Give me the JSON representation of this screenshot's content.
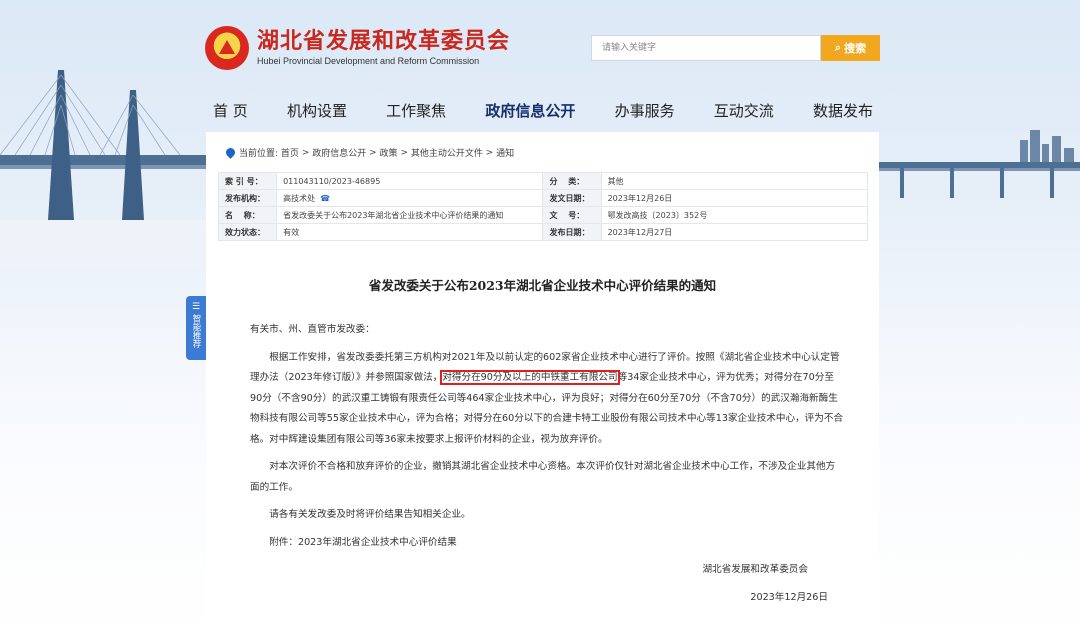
{
  "header": {
    "title_cn": "湖北省发展和改革委员会",
    "title_en": "Hubei Provincial Development and Reform Commission",
    "search_placeholder": "请输入关键字",
    "search_label": "搜索"
  },
  "nav": [
    "首 页",
    "机构设置",
    "工作聚焦",
    "政府信息公开",
    "办事服务",
    "互动交流",
    "数据发布"
  ],
  "nav_active": "政府信息公开",
  "breadcrumb": {
    "label": "当前位置:",
    "items": [
      "首页",
      "政府信息公开",
      "政策",
      "其他主动公开文件",
      "通知"
    ],
    "separator": ">"
  },
  "meta": {
    "index_label": "索 引 号：",
    "index_value": "011043110/2023-46895",
    "category_label": "分　 类：",
    "category_value": "其他",
    "publisher_label": "发布机构：",
    "publisher_value": "高技术处",
    "issue_date_label": "发文日期：",
    "issue_date_value": "2023年12月26日",
    "name_label": "名　 称：",
    "name_value": "省发改委关于公布2023年湖北省企业技术中心评价结果的通知",
    "docno_label": "文　 号：",
    "docno_value": "鄂发改高技〔2023〕352号",
    "status_label": "效力状态：",
    "status_value": "有效",
    "publish_date_label": "发布日期：",
    "publish_date_value": "2023年12月27日"
  },
  "doc": {
    "title": "省发改委关于公布2023年湖北省企业技术中心评价结果的通知",
    "salutation": "有关市、州、直管市发改委：",
    "p1_a": "根据工作安排，省发改委委托第三方机构对2021年及以前认定的602家省企业技术中心进行了评价。按照《湖北省企业技术中心认定管理办法（2023年修订版）》并参照国家做法，",
    "p1_highlight": "对得分在90分及以上的中铁重工有限公司",
    "p1_b": "等34家企业技术中心，评为优秀；对得分在70分至90分（不含90分）的武汉重工铸锻有限责任公司等464家企业技术中心，评为良好；对得分在60分至70分（不含70分）的武汉瀚海新酶生物科技有限公司等55家企业技术中心，评为合格；对得分在60分以下的合建卡特工业股份有限公司技术中心等13家企业技术中心，评为不合格。对中辉建设集团有限公司等36家未按要求上报评价材料的企业，视为放弃评价。",
    "p2": "对本次评价不合格和放弃评价的企业，撤销其湖北省企业技术中心资格。本次评价仅针对湖北省企业技术中心工作，不涉及企业其他方面的工作。",
    "p3": "请各有关发改委及时将评价结果告知相关企业。",
    "attachment": "附件：2023年湖北省企业技术中心评价结果",
    "signer": "湖北省发展和改革委员会",
    "sign_date": "2023年12月26日"
  },
  "side_tab": "智能推荐"
}
